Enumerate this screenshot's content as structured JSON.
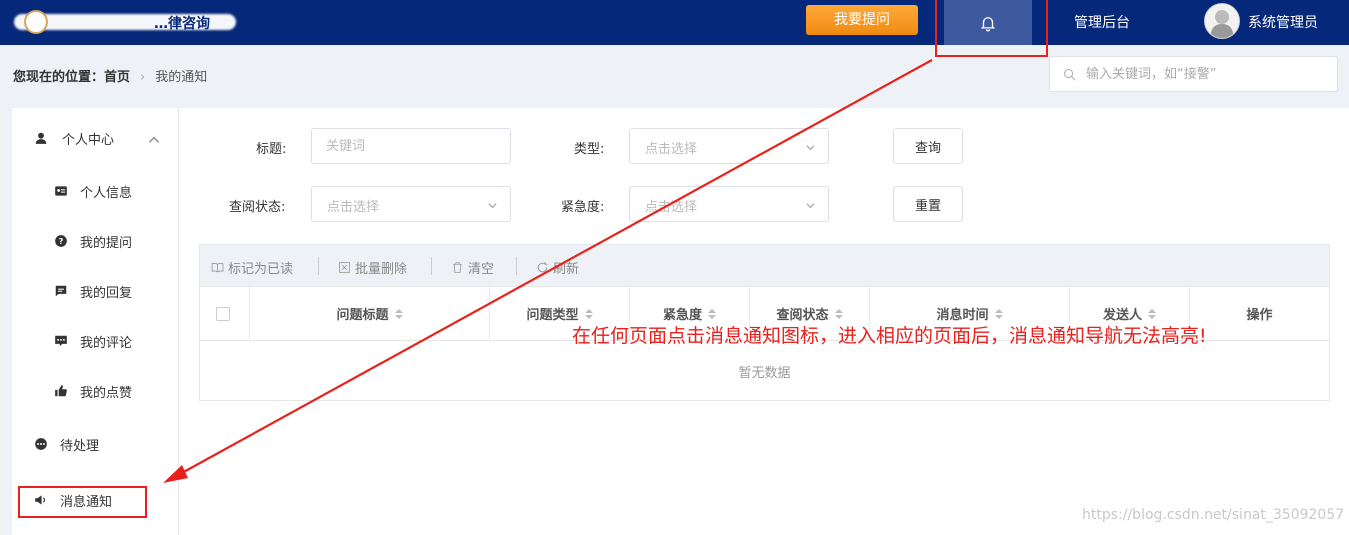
{
  "header": {
    "site_title": "…律咨询",
    "ask_label": "我要提问",
    "bell_icon": "bell-icon",
    "admin_label": "管理后台",
    "user_name": "系统管理员"
  },
  "breadcrumb": {
    "prefix": "您现在的位置：",
    "home": "首页",
    "current": "我的通知"
  },
  "search": {
    "placeholder": "输入关键词，如“接警”"
  },
  "sidebar": {
    "group_label": "个人中心",
    "items": [
      {
        "label": "个人信息",
        "icon": "id-card-icon"
      },
      {
        "label": "我的提问",
        "icon": "question-circle-icon"
      },
      {
        "label": "我的回复",
        "icon": "reply-message-icon"
      },
      {
        "label": "我的评论",
        "icon": "comment-icon"
      },
      {
        "label": "我的点赞",
        "icon": "thumbs-up-icon"
      }
    ],
    "pending_label": "待处理",
    "notice_label": "消息通知"
  },
  "filters": {
    "title_label": "标题:",
    "title_placeholder": "关键词",
    "type_label": "类型:",
    "type_placeholder": "点击选择",
    "status_label": "查阅状态:",
    "status_placeholder": "点击选择",
    "urgency_label": "紧急度:",
    "urgency_placeholder": "点击选择",
    "query_label": "查询",
    "reset_label": "重置"
  },
  "toolbar": {
    "mark_read": "标记为已读",
    "batch_delete": "批量删除",
    "clear": "清空",
    "refresh": "刷新"
  },
  "table": {
    "columns": [
      "问题标题",
      "问题类型",
      "紧急度",
      "查阅状态",
      "消息时间",
      "发送人",
      "操作"
    ],
    "empty_text": "暂无数据"
  },
  "annotation": "在任何页面点击消息通知图标，进入相应的页面后，消息通知导航无法高亮!",
  "watermark": "https://blog.csdn.net/sinat_35092057",
  "colors": {
    "header_bg": "#06287a",
    "accent_orange": "#f59a23",
    "annotation_red": "#e8211c"
  }
}
